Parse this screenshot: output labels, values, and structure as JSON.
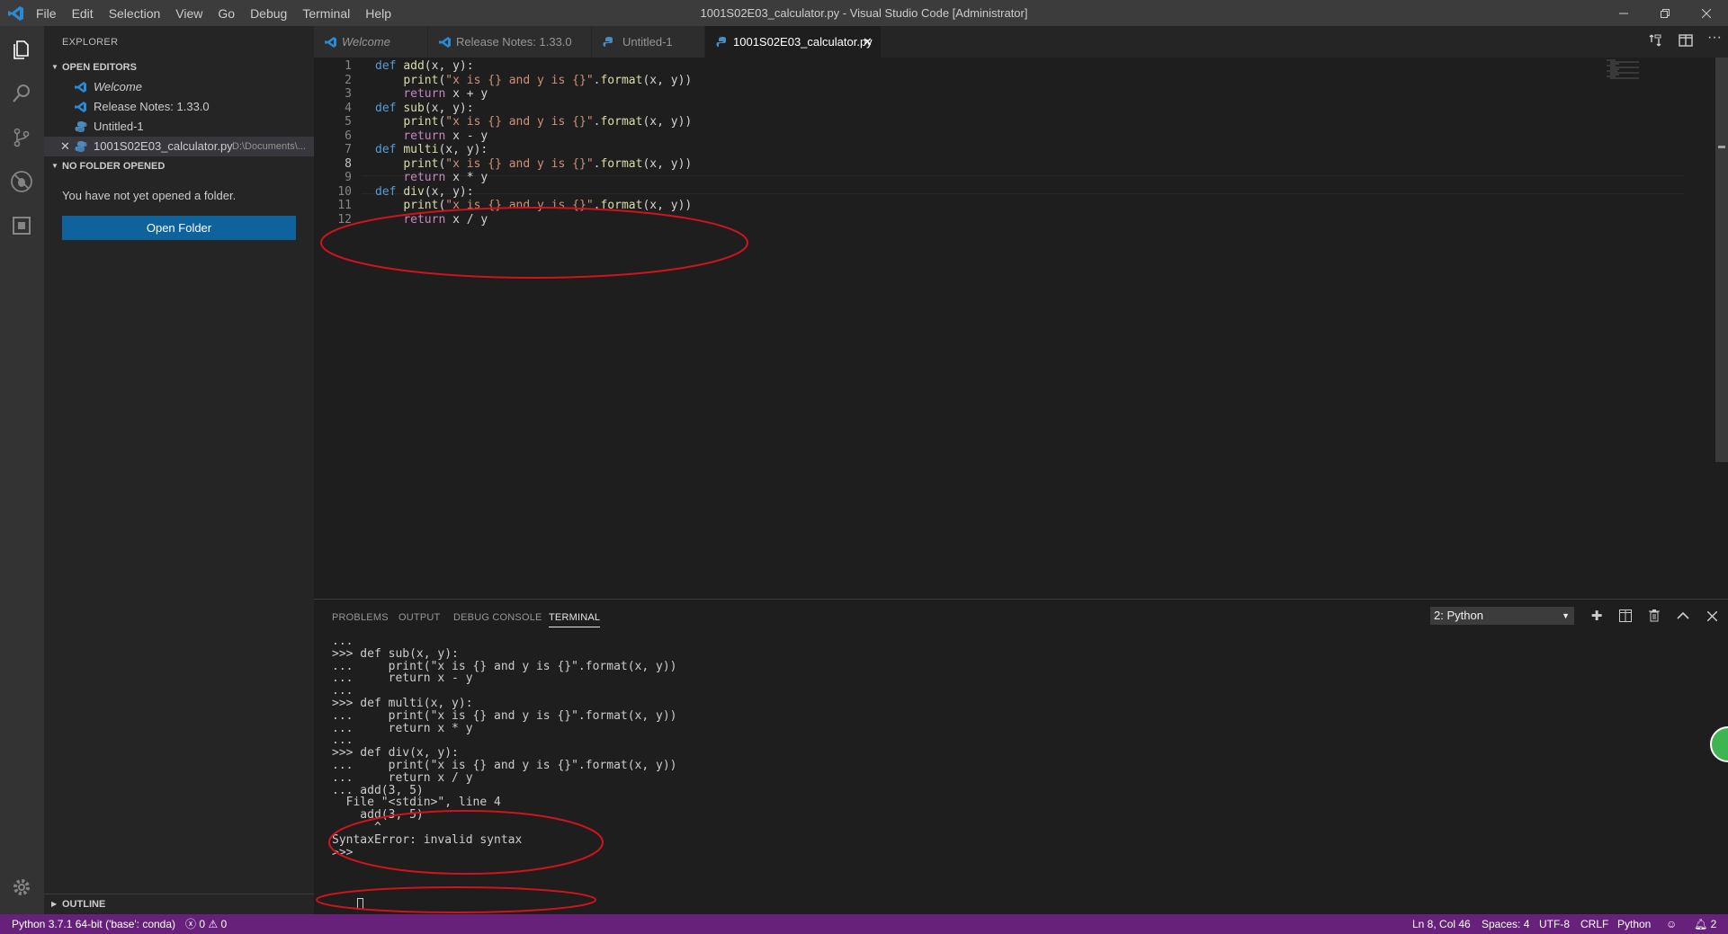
{
  "titlebar": {
    "menu": [
      "File",
      "Edit",
      "Selection",
      "View",
      "Go",
      "Debug",
      "Terminal",
      "Help"
    ],
    "title": "1001S02E03_calculator.py - Visual Studio Code [Administrator]"
  },
  "sidebar": {
    "title": "EXPLORER",
    "open_editors_header": "OPEN EDITORS",
    "open_editors": [
      {
        "label": "Welcome",
        "icon": "vscode-icon"
      },
      {
        "label": "Release Notes: 1.33.0",
        "icon": "vscode-icon"
      },
      {
        "label": "Untitled-1",
        "icon": "python-icon"
      },
      {
        "label": "1001S02E03_calculator.py",
        "path": "D:\\Documents\\...",
        "icon": "python-icon"
      }
    ],
    "no_folder_header": "NO FOLDER OPENED",
    "no_folder_text": "You have not yet opened a folder.",
    "open_folder_button": "Open Folder",
    "outline_header": "OUTLINE"
  },
  "tabs": [
    {
      "label": "Welcome",
      "icon": "vscode-icon",
      "active": false
    },
    {
      "label": "Release Notes: 1.33.0",
      "icon": "vscode-icon",
      "active": false
    },
    {
      "label": "Untitled-1",
      "icon": "python-icon",
      "active": false
    },
    {
      "label": "1001S02E03_calculator.py",
      "icon": "python-icon",
      "active": true
    }
  ],
  "editor": {
    "lines": [
      "def add(x, y):",
      "    print(\"x is {} and y is {}\".format(x, y))",
      "    return x + y",
      "def sub(x, y):",
      "    print(\"x is {} and y is {}\".format(x, y))",
      "    return x - y",
      "def multi(x, y):",
      "    print(\"x is {} and y is {}\".format(x, y))",
      "    return x * y",
      "def div(x, y):",
      "    print(\"x is {} and y is {}\".format(x, y))",
      "    return x / y"
    ],
    "current_line": 8
  },
  "panel": {
    "tabs": [
      "PROBLEMS",
      "OUTPUT",
      "DEBUG CONSOLE",
      "TERMINAL"
    ],
    "active_tab": "TERMINAL",
    "terminal_select": "2: Python",
    "terminal_lines": [
      "...",
      ">>> def sub(x, y):",
      "...     print(\"x is {} and y is {}\".format(x, y))",
      "...     return x - y",
      "...",
      ">>> def multi(x, y):",
      "...     print(\"x is {} and y is {}\".format(x, y))",
      "...     return x * y",
      "...",
      ">>> def div(x, y):",
      "...     print(\"x is {} and y is {}\".format(x, y))",
      "...     return x / y",
      "... add(3, 5)",
      "  File \"<stdin>\", line 4",
      "    add(3, 5)",
      "      ^",
      "SyntaxError: invalid syntax",
      ">>> "
    ]
  },
  "statusbar": {
    "interpreter": "Python 3.7.1 64-bit ('base': conda)",
    "errors": "0",
    "warnings": "0",
    "position": "Ln 8, Col 46",
    "spaces": "Spaces: 4",
    "encoding": "UTF-8",
    "eol": "CRLF",
    "language": "Python",
    "notifications": "2"
  },
  "colors": {
    "statusbar": "#68217a",
    "annotation": "#d0141c",
    "button": "#0e639c"
  }
}
